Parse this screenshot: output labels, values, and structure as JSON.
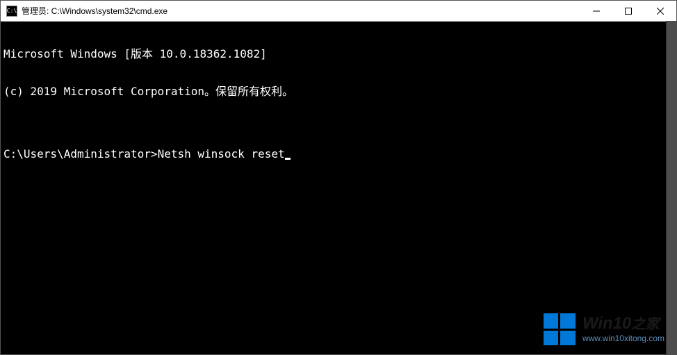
{
  "titlebar": {
    "icon_label": "C:\\",
    "title": "管理员: C:\\Windows\\system32\\cmd.exe"
  },
  "terminal": {
    "line1": "Microsoft Windows [版本 10.0.18362.1082]",
    "line2": "(c) 2019 Microsoft Corporation。保留所有权利。",
    "blank": "",
    "prompt": "C:\\Users\\Administrator>",
    "command": "Netsh winsock reset"
  },
  "watermark": {
    "title_main": "Win10",
    "title_sub": "之家",
    "url": "www.win10xitong.com"
  }
}
